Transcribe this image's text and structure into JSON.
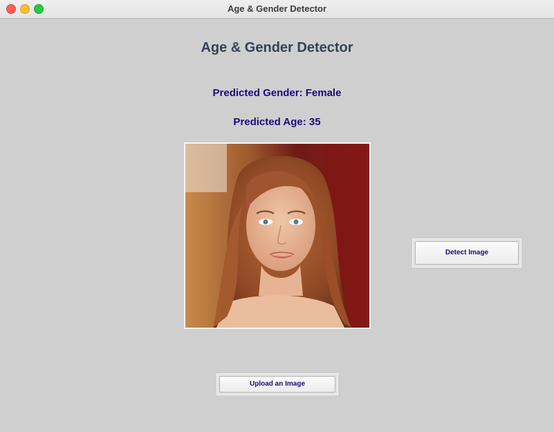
{
  "window": {
    "title": "Age & Gender Detector"
  },
  "main": {
    "heading": "Age & Gender Detector",
    "gender_label": "Predicted Gender: Female",
    "age_label": "Predicted Age: 35"
  },
  "buttons": {
    "detect_label": "Detect Image",
    "upload_label": "Upload an Image"
  },
  "colors": {
    "background": "#cfcfcf",
    "heading": "#364156",
    "result_text": "#1b0a7e"
  }
}
